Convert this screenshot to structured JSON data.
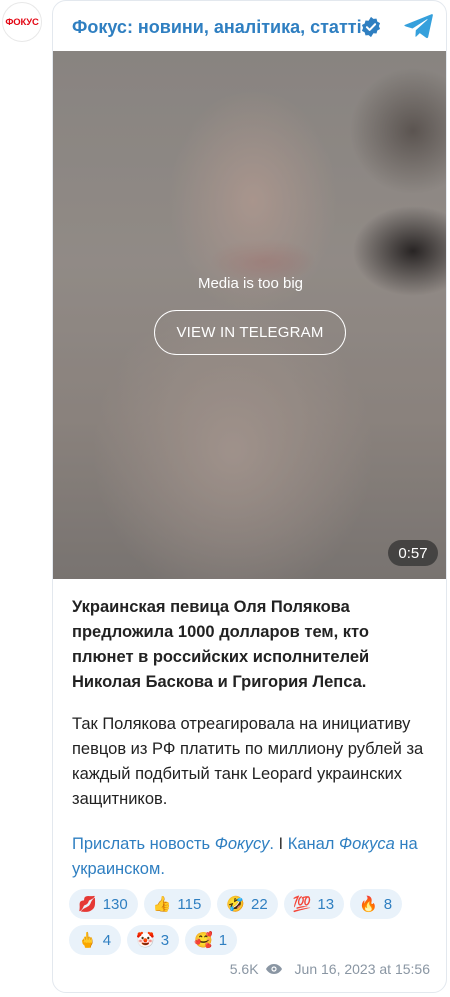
{
  "channel": {
    "avatar_text": "ФОКУС",
    "title": "Фокус: новини, аналітика, статті",
    "brand_color": "#e30613",
    "link_color": "#2f7fc1"
  },
  "media": {
    "message": "Media is too big",
    "button_label": "VIEW IN TELEGRAM",
    "duration": "0:57"
  },
  "post": {
    "headline": "Украинская певица Оля Полякова предложила 1000 долларов тем, кто плюнет в российских исполнителей Николая Баскова и Григория Лепса.",
    "body": "Так Полякова отреагировала на инициативу певцов из РФ платить по миллиону рублей за каждый подбитый танк Leopard украинских защитников.",
    "link1_a": "Прислать новость ",
    "link1_b": "Фокусу",
    "link1_c": ".",
    "separator": " I ",
    "link2_a": "Канал ",
    "link2_b": "Фокуса",
    "link2_c": " на украинском."
  },
  "reactions": [
    [
      {
        "emoji": "💋",
        "count": "130"
      },
      {
        "emoji": "👍",
        "count": "115"
      },
      {
        "emoji": "🤣",
        "count": "22"
      },
      {
        "emoji": "💯",
        "count": "13"
      },
      {
        "emoji": "🔥",
        "count": "8"
      }
    ],
    [
      {
        "emoji": "🖕",
        "count": "4"
      },
      {
        "emoji": "🤡",
        "count": "3"
      },
      {
        "emoji": "🥰",
        "count": "1"
      }
    ]
  ],
  "footer": {
    "views": "5.6K",
    "date": "Jun 16, 2023 at 15:56"
  }
}
